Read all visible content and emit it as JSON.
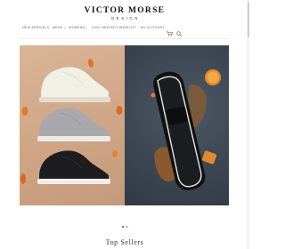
{
  "brand": {
    "title": "VICTOR MORSE",
    "subtitle": "DESIGN"
  },
  "nav": {
    "items": [
      {
        "label": "NEW ARRIVALS",
        "has_dropdown": false
      },
      {
        "label": "MENS",
        "has_dropdown": true
      },
      {
        "label": "WOMENS",
        "has_dropdown": true
      },
      {
        "label": "AXEL ARIGATO",
        "has_dropdown": false
      },
      {
        "label": "WISHLIST",
        "has_dropdown": false
      },
      {
        "label": "MY ACCOUNT",
        "has_dropdown": false
      }
    ],
    "cart_icon": "cart-icon",
    "search_icon": "search-icon"
  },
  "hero": {
    "left_image": "white, grey and black sneakers stacked on beige background with orange fruit",
    "right_image": "black slip-on sneaker on dark grey background with orange slices and bread"
  },
  "slider": {
    "slide_count": 2,
    "active_index": 0
  },
  "section": {
    "title": "Top Sellers"
  },
  "colors": {
    "nav_text": "#666666",
    "brand": "#111111",
    "hero_left_bg": "#cfa585",
    "hero_right_bg": "#3b4550"
  }
}
